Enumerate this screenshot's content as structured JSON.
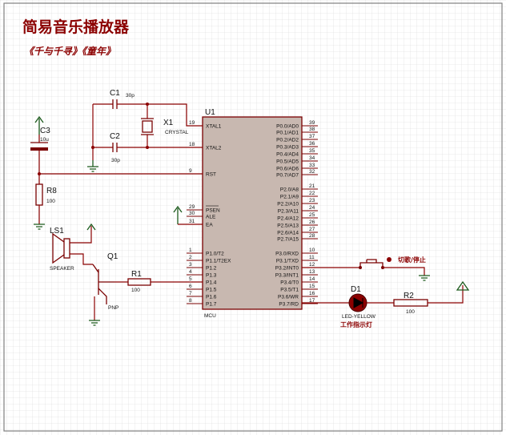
{
  "title": "简易音乐播放器",
  "subtitle": "《千与千寻》《童年》",
  "components": {
    "c1": {
      "ref": "C1",
      "value": "30p"
    },
    "c2": {
      "ref": "C2",
      "value": "30p"
    },
    "c3": {
      "ref": "C3",
      "value": "10u"
    },
    "x1": {
      "ref": "X1",
      "value": "CRYSTAL"
    },
    "r8": {
      "ref": "R8",
      "value": "100"
    },
    "ls1": {
      "ref": "LS1",
      "value": "SPEAKER"
    },
    "q1": {
      "ref": "Q1",
      "value": "PNP"
    },
    "r1": {
      "ref": "R1",
      "value": "100"
    },
    "u1": {
      "ref": "U1",
      "value": "MCU"
    },
    "d1": {
      "ref": "D1",
      "value": "LED-YELLOW"
    },
    "r2": {
      "ref": "R2",
      "value": "100"
    }
  },
  "labels": {
    "switch": "切歌/停止",
    "led": "工作指示灯"
  },
  "mcu_left_pins": [
    {
      "num": "19",
      "name": "XTAL1"
    },
    {
      "num": "18",
      "name": "XTAL2"
    },
    {
      "num": "9",
      "name": "RST"
    },
    {
      "num": "29",
      "name": "PSEN"
    },
    {
      "num": "30",
      "name": "ALE"
    },
    {
      "num": "31",
      "name": "EA"
    },
    {
      "num": "1",
      "name": "P1.0/T2"
    },
    {
      "num": "2",
      "name": "P1.1/T2EX"
    },
    {
      "num": "3",
      "name": "P1.2"
    },
    {
      "num": "4",
      "name": "P1.3"
    },
    {
      "num": "5",
      "name": "P1.4"
    },
    {
      "num": "6",
      "name": "P1.5"
    },
    {
      "num": "7",
      "name": "P1.6"
    },
    {
      "num": "8",
      "name": "P1.7"
    }
  ],
  "mcu_right_pins": [
    {
      "num": "39",
      "name": "P0.0/AD0"
    },
    {
      "num": "38",
      "name": "P0.1/AD1"
    },
    {
      "num": "37",
      "name": "P0.2/AD2"
    },
    {
      "num": "36",
      "name": "P0.3/AD3"
    },
    {
      "num": "35",
      "name": "P0.4/AD4"
    },
    {
      "num": "34",
      "name": "P0.5/AD5"
    },
    {
      "num": "33",
      "name": "P0.6/AD6"
    },
    {
      "num": "32",
      "name": "P0.7/AD7"
    },
    {
      "num": "21",
      "name": "P2.0/A8"
    },
    {
      "num": "22",
      "name": "P2.1/A9"
    },
    {
      "num": "23",
      "name": "P2.2/A10"
    },
    {
      "num": "24",
      "name": "P2.3/A11"
    },
    {
      "num": "25",
      "name": "P2.4/A12"
    },
    {
      "num": "26",
      "name": "P2.5/A13"
    },
    {
      "num": "27",
      "name": "P2.6/A14"
    },
    {
      "num": "28",
      "name": "P2.7/A15"
    },
    {
      "num": "10",
      "name": "P3.0/RXD"
    },
    {
      "num": "11",
      "name": "P3.1/TXD"
    },
    {
      "num": "12",
      "name": "P3.2/INT0"
    },
    {
      "num": "13",
      "name": "P3.3/INT1"
    },
    {
      "num": "14",
      "name": "P3.4/T0"
    },
    {
      "num": "15",
      "name": "P3.5/T1"
    },
    {
      "num": "16",
      "name": "P3.6/WR"
    },
    {
      "num": "17",
      "name": "P3.7/RD"
    }
  ],
  "colors": {
    "grid": "#d9d9d9",
    "border": "#808080",
    "wire": "#8b0000",
    "chip_fill": "#c8b8b0",
    "ground": "#1c5a1c",
    "led": "#8b0000"
  }
}
